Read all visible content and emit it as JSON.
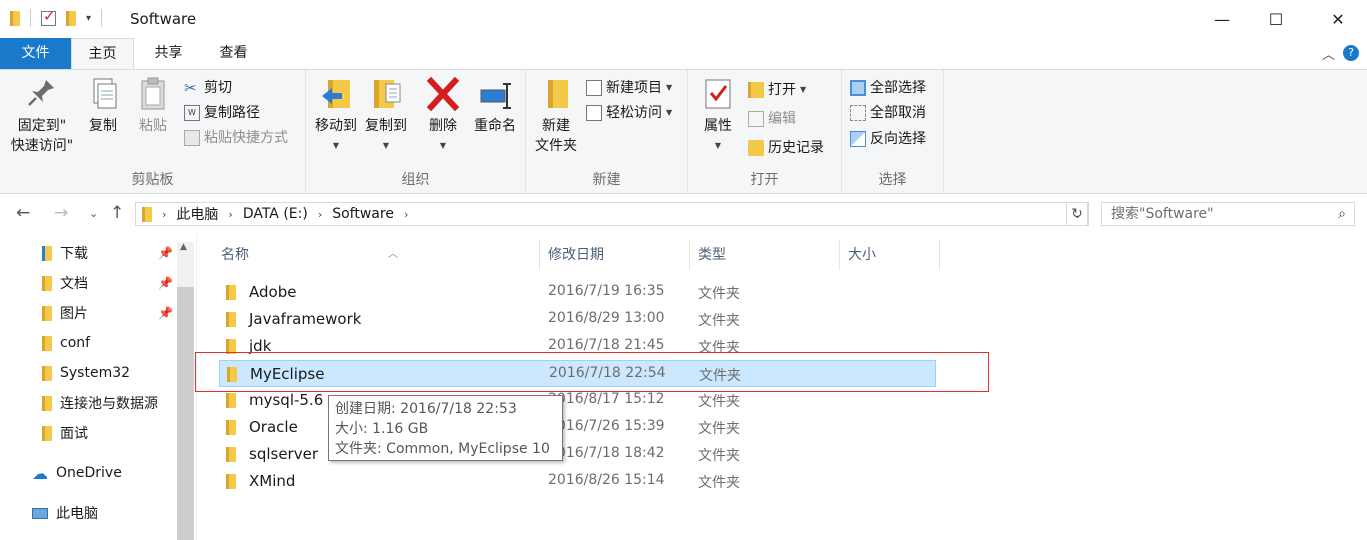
{
  "window": {
    "title": "Software",
    "minimize": "—",
    "maximize": "☐",
    "close": "✕"
  },
  "tabs": {
    "file": "文件",
    "home": "主页",
    "share": "共享",
    "view": "查看"
  },
  "ribbon": {
    "clipboard": {
      "label": "剪贴板",
      "pin": "固定到\"\n快速访问\"",
      "pin_l1": "固定到\"",
      "pin_l2": "快速访问\"",
      "copy": "复制",
      "paste": "粘贴",
      "cut": "剪切",
      "copy_path": "复制路径",
      "paste_shortcut": "粘贴快捷方式"
    },
    "organize": {
      "label": "组织",
      "move_to": "移动到",
      "copy_to": "复制到",
      "delete": "删除",
      "rename": "重命名"
    },
    "new": {
      "label": "新建",
      "new_folder_l1": "新建",
      "new_folder_l2": "文件夹",
      "new_item": "新建项目",
      "easy_access": "轻松访问"
    },
    "open": {
      "label": "打开",
      "properties": "属性",
      "open": "打开",
      "edit": "编辑",
      "history": "历史记录"
    },
    "select": {
      "label": "选择",
      "select_all": "全部选择",
      "select_none": "全部取消",
      "invert": "反向选择"
    }
  },
  "address": {
    "crumbs": [
      "此电脑",
      "DATA (E:)",
      "Software"
    ],
    "search_placeholder": "搜索\"Software\""
  },
  "nav": {
    "items": [
      "下载",
      "文档",
      "图片",
      "conf",
      "System32",
      "连接池与数据源",
      "面试",
      "OneDrive",
      "此电脑"
    ]
  },
  "columns": {
    "name": "名称",
    "date": "修改日期",
    "type": "类型",
    "size": "大小"
  },
  "files": [
    {
      "name": "Adobe",
      "date": "2016/7/19 16:35",
      "type": "文件夹"
    },
    {
      "name": "Javaframework",
      "date": "2016/8/29 13:00",
      "type": "文件夹"
    },
    {
      "name": "jdk",
      "date": "2016/7/18 21:45",
      "type": "文件夹"
    },
    {
      "name": "MyEclipse",
      "date": "2016/7/18 22:54",
      "type": "文件夹"
    },
    {
      "name": "mysql-5.6",
      "date": "2016/8/17 15:12",
      "type": "文件夹"
    },
    {
      "name": "Oracle",
      "date": "2016/7/26 15:39",
      "type": "文件夹"
    },
    {
      "name": "sqlserver",
      "date": "2016/7/18 18:42",
      "type": "文件夹"
    },
    {
      "name": "XMind",
      "date": "2016/8/26 15:14",
      "type": "文件夹"
    }
  ],
  "tooltip": {
    "created": "创建日期: 2016/7/18 22:53",
    "size": "大小: 1.16 GB",
    "folders": "文件夹: Common, MyEclipse 10"
  }
}
